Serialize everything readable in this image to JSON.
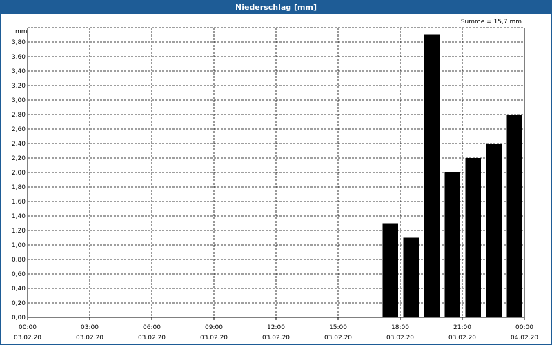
{
  "window": {
    "title": "Niederschlag [mm]"
  },
  "chart_data": {
    "type": "bar",
    "title": "Niederschlag [mm]",
    "ylabel": "mm",
    "annotation": "Summe = 15,7 mm",
    "ylim": [
      0,
      4.0
    ],
    "yticks": [
      "0,00",
      "0,20",
      "0,40",
      "0,60",
      "0,80",
      "1,00",
      "1,20",
      "1,40",
      "1,60",
      "1,80",
      "2,00",
      "2,20",
      "2,40",
      "2,60",
      "2,80",
      "3,00",
      "3,20",
      "3,40",
      "3,60",
      "3,80"
    ],
    "x_range_hours": [
      0,
      24
    ],
    "xticks": [
      {
        "time": "00:00",
        "date": "03.02.20"
      },
      {
        "time": "03:00",
        "date": "03.02.20"
      },
      {
        "time": "06:00",
        "date": "03.02.20"
      },
      {
        "time": "09:00",
        "date": "03.02.20"
      },
      {
        "time": "12:00",
        "date": "03.02.20"
      },
      {
        "time": "15:00",
        "date": "03.02.20"
      },
      {
        "time": "18:00",
        "date": "03.02.20"
      },
      {
        "time": "21:00",
        "date": "03.02.20"
      },
      {
        "time": "00:00",
        "date": "04.02.20"
      }
    ],
    "bars": [
      {
        "hour": 18,
        "value": 1.3
      },
      {
        "hour": 19,
        "value": 1.1
      },
      {
        "hour": 20,
        "value": 3.9
      },
      {
        "hour": 21,
        "value": 2.0
      },
      {
        "hour": 22,
        "value": 2.2
      },
      {
        "hour": 23,
        "value": 2.4
      },
      {
        "hour": 24,
        "value": 2.8
      }
    ],
    "bar_color": "#000000",
    "grid": true
  }
}
